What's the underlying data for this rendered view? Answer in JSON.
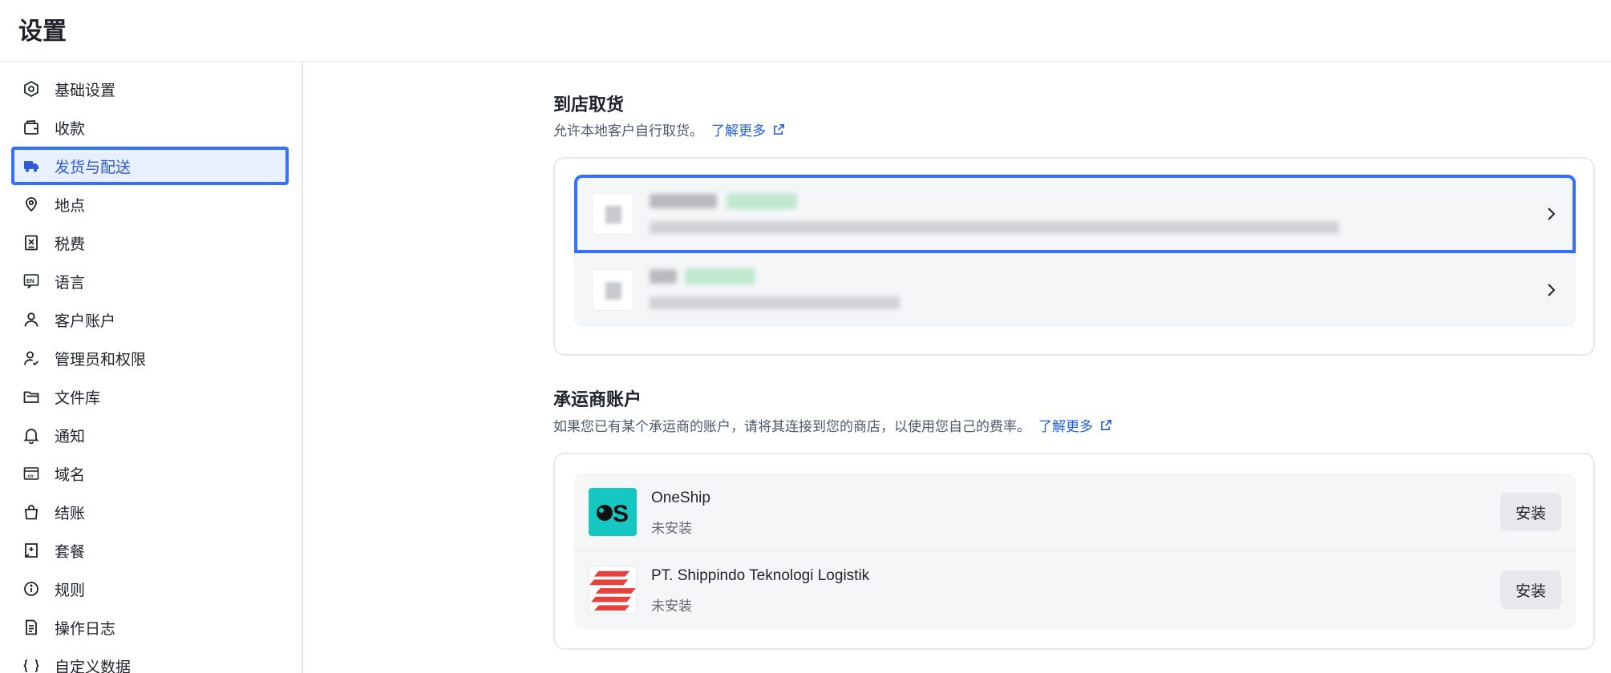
{
  "header": {
    "title": "设置"
  },
  "sidebar": {
    "items": [
      {
        "label": "基础设置",
        "icon": "settings-hex-icon"
      },
      {
        "label": "收款",
        "icon": "wallet-icon"
      },
      {
        "label": "发货与配送",
        "icon": "truck-icon",
        "active": true
      },
      {
        "label": "地点",
        "icon": "location-pin-icon"
      },
      {
        "label": "税费",
        "icon": "tax-receipt-icon"
      },
      {
        "label": "语言",
        "icon": "language-en-icon"
      },
      {
        "label": "客户账户",
        "icon": "user-icon"
      },
      {
        "label": "管理员和权限",
        "icon": "user-check-icon"
      },
      {
        "label": "文件库",
        "icon": "folder-icon"
      },
      {
        "label": "通知",
        "icon": "bell-icon"
      },
      {
        "label": "域名",
        "icon": "domain-icon"
      },
      {
        "label": "结账",
        "icon": "shopping-bag-icon"
      },
      {
        "label": "套餐",
        "icon": "plan-icon"
      },
      {
        "label": "规则",
        "icon": "info-icon"
      },
      {
        "label": "操作日志",
        "icon": "log-icon"
      },
      {
        "label": "自定义数据",
        "icon": "custom-data-icon"
      }
    ]
  },
  "pickup": {
    "title": "到店取货",
    "desc": "允许本地客户自行取货。",
    "link": "了解更多"
  },
  "carrier": {
    "title": "承运商账户",
    "desc": "如果您已有某个承运商的账户，请将其连接到您的商店，以使用您自己的费率。",
    "link": "了解更多",
    "items": [
      {
        "name": "OneShip",
        "status": "未安装",
        "button": "安装"
      },
      {
        "name": "PT. Shippindo Teknologi Logistik",
        "status": "未安装",
        "button": "安装"
      }
    ]
  },
  "colors": {
    "accent": "#3370ff",
    "link": "#1f5fe0",
    "oneship": "#16c7c1",
    "shippindo": "#e8403c"
  }
}
